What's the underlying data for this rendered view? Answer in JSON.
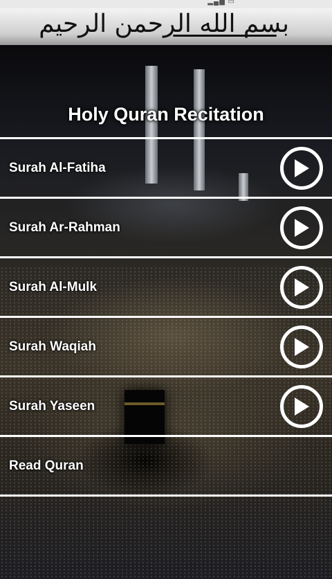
{
  "header": {
    "calligraphy": "بسم الله الرحمن الرحيم"
  },
  "page": {
    "title": "Holy Quran Recitation"
  },
  "items": [
    {
      "label": "Surah Al-Fatiha",
      "icon": "play-icon"
    },
    {
      "label": "Surah Ar-Rahman",
      "icon": "play-icon"
    },
    {
      "label": "Surah Al-Mulk",
      "icon": "play-icon"
    },
    {
      "label": "Surah Waqiah",
      "icon": "play-icon"
    },
    {
      "label": "Surah Yaseen",
      "icon": "play-icon"
    },
    {
      "label": "Read Quran"
    }
  ],
  "colors": {
    "text": "#ffffff",
    "divider": "#ffffff"
  }
}
